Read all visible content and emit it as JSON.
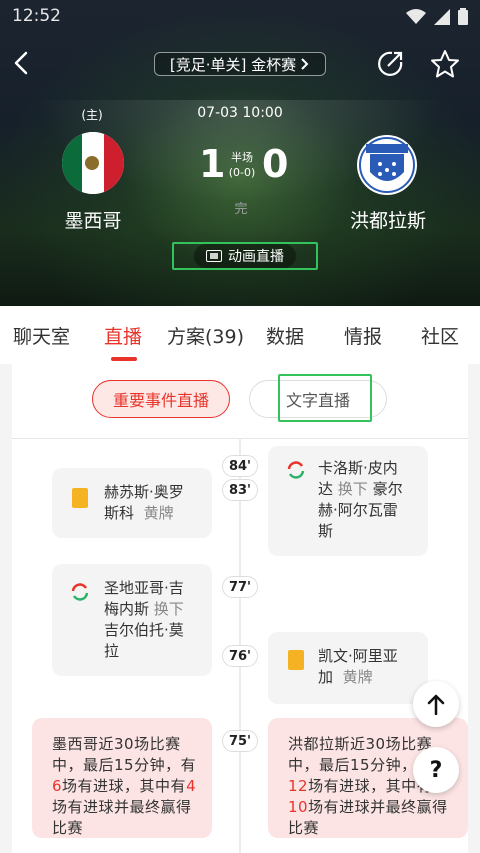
{
  "status_bar": {
    "time": "12:52"
  },
  "header": {
    "competition": "[竞足·单关] 金杯赛",
    "datetime": "07-03 10:00",
    "home_tag": "(主)",
    "home_team": "墨西哥",
    "away_team": "洪都拉斯",
    "score_home": "1",
    "score_away": "0",
    "half_label": "半场",
    "half_score": "(0-0)",
    "state": "完",
    "animation_label": "动画直播"
  },
  "tabs": [
    {
      "label": "聊天室"
    },
    {
      "label": "直播"
    },
    {
      "label": "方案(39)"
    },
    {
      "label": "数据"
    },
    {
      "label": "情报"
    },
    {
      "label": "社区"
    }
  ],
  "active_tab": "直播",
  "segments": {
    "key_events": "重要事件直播",
    "text_live": "文字直播"
  },
  "events": [
    {
      "minute": "84'"
    },
    {
      "minute": "83'"
    },
    {
      "minute": "77'"
    },
    {
      "minute": "76'"
    },
    {
      "minute": "75'"
    }
  ],
  "cards": {
    "c83_line1": "赫苏斯·奥罗",
    "c83_line2": "斯科",
    "c83_tag": "黄牌",
    "c84_line1": "卡洛斯·皮内",
    "c84_line2a": "达",
    "c84_tag": "换下",
    "c84_line2b": "豪尔",
    "c84_line3": "赫·阿尔瓦雷",
    "c84_line4": "斯",
    "c77_line1": "圣地亚哥·吉",
    "c77_line2a": "梅内斯",
    "c77_tag": "换下",
    "c77_line3": "吉尔伯托·莫",
    "c77_line4": "拉",
    "c76_line1": "凯文·阿里亚",
    "c76_line2": "加",
    "c76_tag": "黄牌"
  },
  "stats": {
    "left_l1": "墨西哥近30场比赛",
    "left_l2a": "中，最后15分钟，有",
    "left_n1": "6",
    "left_l3": "场有进球，其中有",
    "left_n2": "4",
    "left_l4": "场有进球并最终赢得",
    "left_l5": "比赛",
    "right_l1": "洪都拉斯近30场比赛",
    "right_l2": "中，最后15分钟，有",
    "right_n1": "12",
    "right_l3": "场有进球，其中有",
    "right_n2": "10",
    "right_l4": "场有进球并最终赢得",
    "right_l5": "比赛"
  },
  "float": {
    "top_icon": "arrow-up-icon",
    "help": "?"
  },
  "colors": {
    "accent": "#e8342b",
    "highlight": "#34c25c",
    "yellow": "#f5b324"
  }
}
